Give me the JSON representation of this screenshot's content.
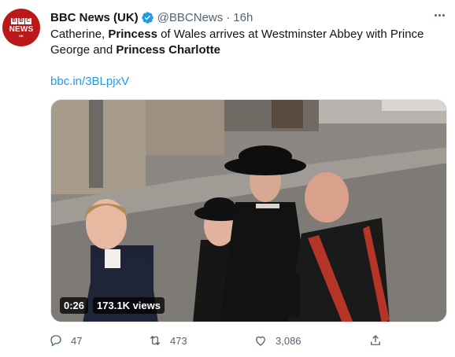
{
  "avatar": {
    "boxes": [
      "B",
      "B",
      "C"
    ],
    "line2": "NEWS",
    "line3": "UK"
  },
  "header": {
    "name": "BBC News (UK)",
    "handle": "@BBCNews",
    "separator": "·",
    "time": "16h"
  },
  "tweet": {
    "seg1": "Catherine, ",
    "seg2": "Princess",
    "seg3": " of Wales arrives at Westminster Abbey with Prince George and ",
    "seg4": "Princess Charlotte",
    "link": "bbc.in/3BLpjxV"
  },
  "video": {
    "duration": "0:26",
    "views": "173.1K views"
  },
  "actions": {
    "replies": "47",
    "retweets": "473",
    "likes": "3,086"
  },
  "colors": {
    "accent": "#1d9bf0",
    "bbc_red": "#bb1919",
    "muted": "#536471"
  },
  "icons": [
    "verified-icon",
    "more-icon",
    "reply-icon",
    "retweet-icon",
    "like-icon",
    "share-icon"
  ]
}
